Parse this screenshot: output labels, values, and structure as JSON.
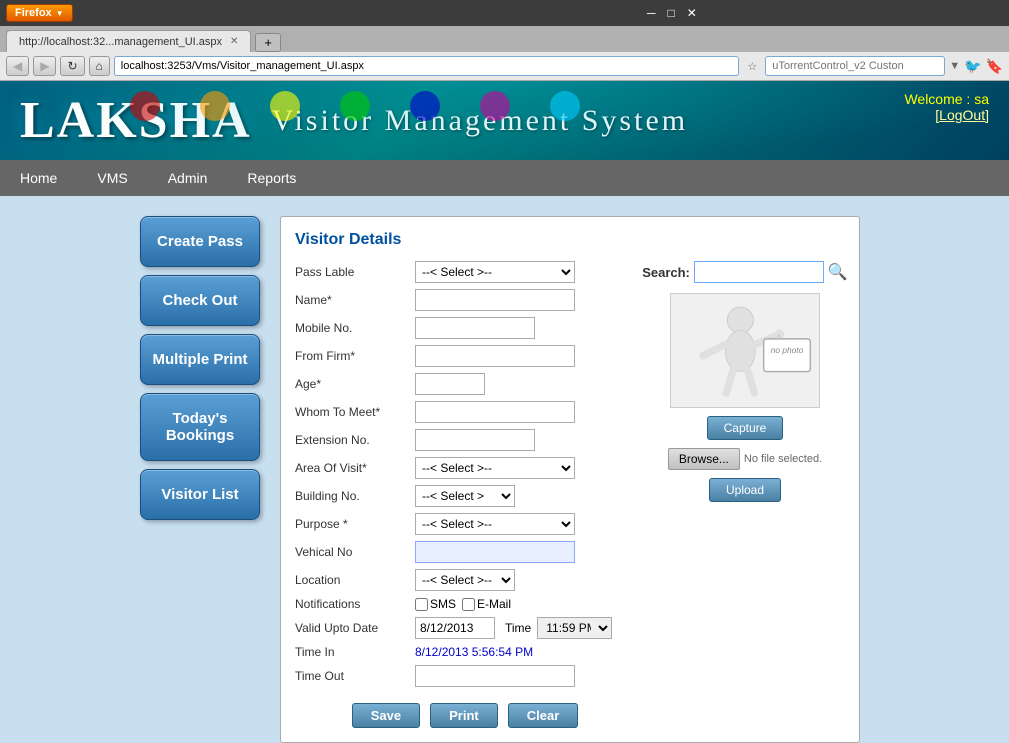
{
  "browser": {
    "firefox_label": "Firefox",
    "url": "localhost:3253/Vms/Visitor_management_UI.aspx",
    "tab_title": "http://localhost:32...management_UI.aspx",
    "search_placeholder": "uTorrentControl_v2 Custon"
  },
  "header": {
    "title_main": "LAKSHA",
    "title_sub": "Visitor Management System",
    "welcome": "Welcome :  sa",
    "logout": "[LogOut]"
  },
  "nav": {
    "items": [
      "Home",
      "VMS",
      "Admin",
      "Reports"
    ]
  },
  "sidebar": {
    "buttons": [
      "Create Pass",
      "Check Out",
      "Multiple Print",
      "Today's Bookings",
      "Visitor List"
    ]
  },
  "form": {
    "title": "Visitor Details",
    "search_label": "Search:",
    "search_placeholder": "",
    "fields": {
      "pass_label": "Pass Lable",
      "name": "Name*",
      "mobile": "Mobile No.",
      "from_firm": "From Firm*",
      "age": "Age*",
      "whom_to_meet": "Whom To Meet*",
      "extension_no": "Extension No.",
      "area_of_visit": "Area Of Visit*",
      "building_no": "Building No.",
      "purpose": "Purpose *",
      "vehical_no": "Vehical No",
      "location": "Location",
      "notifications": "Notifications",
      "valid_upto": "Valid Upto Date",
      "time": "Time",
      "time_in": "Time In",
      "time_out": "Time Out"
    },
    "selects": {
      "pass_label_default": "--< Select >--",
      "area_default": "--< Select >--",
      "building_default": "--< Select >",
      "purpose_default": "--< Select >--",
      "location_default": "--< Select >--"
    },
    "valid_date": "8/12/2013",
    "valid_time": "11:59 PM",
    "time_in_val": "8/12/2013 5:56:54 PM",
    "time_out_val": "",
    "sms_label": "SMS",
    "email_label": "E-Mail",
    "no_file": "No file selected.",
    "buttons": {
      "capture": "Capture",
      "browse": "Browse...",
      "upload": "Upload",
      "save": "Save",
      "print": "Print",
      "clear": "Clear"
    }
  }
}
